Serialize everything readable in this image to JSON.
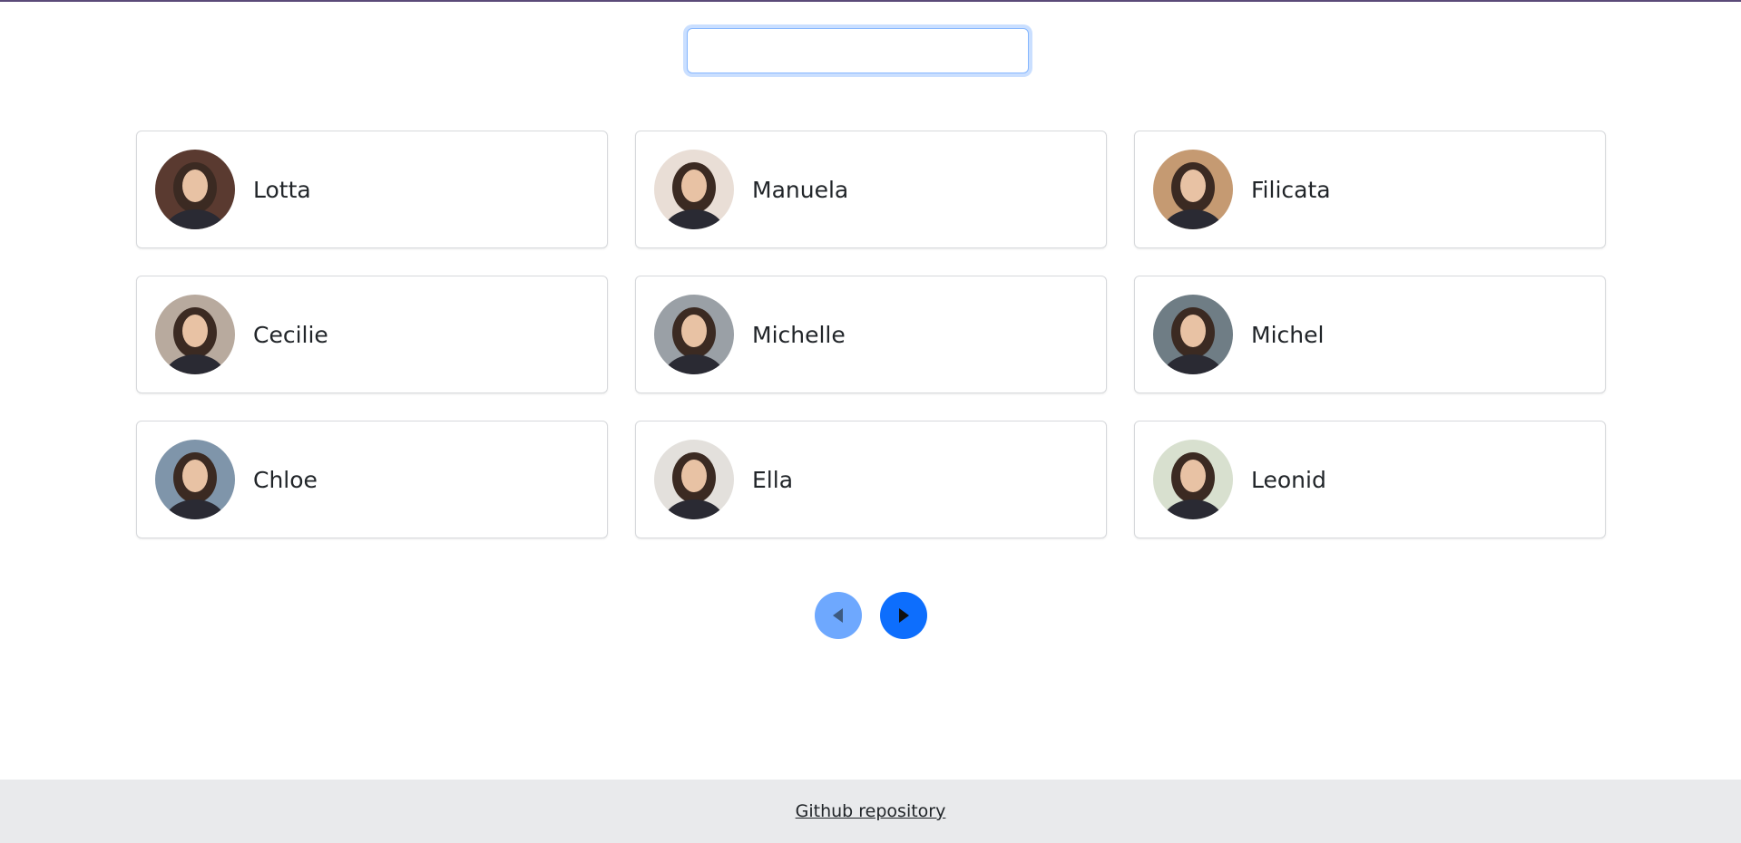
{
  "search": {
    "value": "",
    "placeholder": ""
  },
  "cards": [
    {
      "name": "Lotta",
      "photo": "woman-portrait",
      "tone": "#5a3a30"
    },
    {
      "name": "Manuela",
      "photo": "woman-portrait",
      "tone": "#e9ded6"
    },
    {
      "name": "Filicata",
      "photo": "woman-portrait",
      "tone": "#c59a72"
    },
    {
      "name": "Cecilie",
      "photo": "woman-portrait",
      "tone": "#b8aa9e"
    },
    {
      "name": "Michelle",
      "photo": "woman-portrait",
      "tone": "#9aa0a6"
    },
    {
      "name": "Michel",
      "photo": "woman-portrait",
      "tone": "#6f7d85"
    },
    {
      "name": "Chloe",
      "photo": "woman-portrait",
      "tone": "#7f95aa"
    },
    {
      "name": "Ella",
      "photo": "woman-portrait",
      "tone": "#e3e0dc"
    },
    {
      "name": "Leonid",
      "photo": "man-portrait",
      "tone": "#d8e0cf"
    }
  ],
  "pagination": {
    "prev_icon": "caret-left-icon",
    "next_icon": "caret-right-icon",
    "prev_color": "#6ea8fe",
    "next_color": "#0d6efd"
  },
  "footer": {
    "link_text": "Github repository"
  }
}
